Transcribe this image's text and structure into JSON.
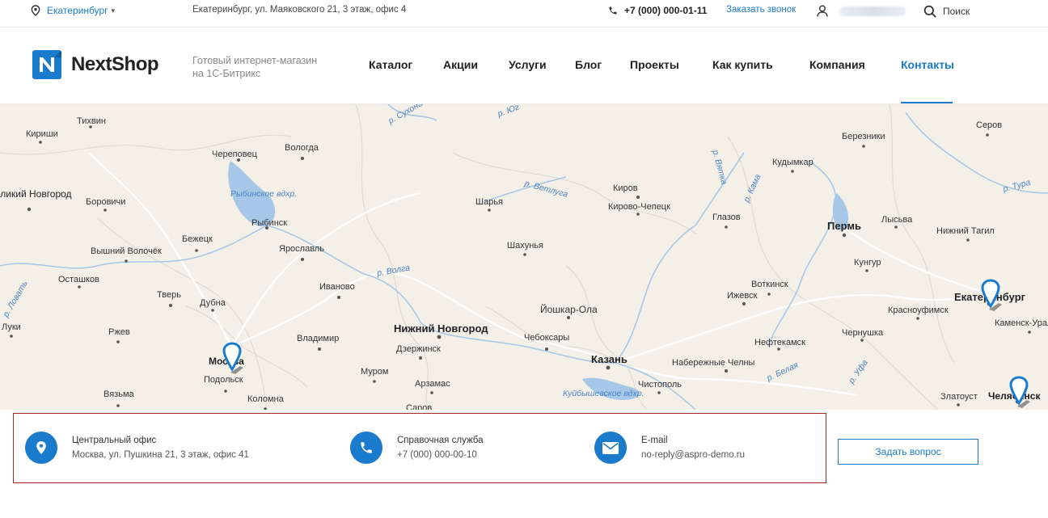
{
  "topbar": {
    "city": "Екатеринбург",
    "address": "Екатеринбург, ул. Маяковского 21, 3 этаж, офис 4",
    "phone": "+7 (000) 000-01-11",
    "callback": "Заказать звонок",
    "search": "Поиск"
  },
  "header": {
    "logo_letter": "N",
    "logo_name": "NextShop",
    "tagline": "Готовый интернет-магазин на 1С-Битрикс",
    "accent_color": "#1a7acb"
  },
  "nav": {
    "items": [
      {
        "label": "Каталог"
      },
      {
        "label": "Акции"
      },
      {
        "label": "Услуги"
      },
      {
        "label": "Блог"
      },
      {
        "label": "Проекты"
      },
      {
        "label": "Как купить"
      },
      {
        "label": "Компания"
      },
      {
        "label": "Контакты",
        "active": true
      }
    ]
  },
  "map": {
    "cities": [
      "Тихвин",
      "Кириши",
      "Череповец",
      "Вологда",
      "Великий Новгород",
      "Боровичи",
      "Рыбинск",
      "Бежецк",
      "Вышний Волочёк",
      "Ярославль",
      "Осташков",
      "Тверь",
      "Дубна",
      "Иваново",
      "Луки",
      "Ржев",
      "Москва",
      "Подольск",
      "Вязьма",
      "Коломна",
      "Владимир",
      "Нижний Новгород",
      "Дзержинск",
      "Муром",
      "Арзамас",
      "Саров",
      "Шарья",
      "Шахунья",
      "Йошкар-Ола",
      "Чебоксары",
      "Казань",
      "Киров",
      "Кирово-Чепецк",
      "Глазов",
      "Кудымкар",
      "Березники",
      "Серов",
      "Пермь",
      "Лысьва",
      "Нижний Тагил",
      "Кунгур",
      "Воткинск",
      "Ижевск",
      "Красноуфимск",
      "Екатеринбург",
      "Каменск-Уральский",
      "Нефтекамск",
      "Чернушка",
      "Набережные Челны",
      "Чистополь",
      "Златоуст",
      "Челябинск"
    ],
    "rivers": [
      "р. Сухона",
      "р. Юг",
      "р. Ветлуга",
      "р. Вятка",
      "р. Кама",
      "р. Тура",
      "р. Ловать",
      "р. Волга",
      "р. Белая",
      "р. Уфа"
    ],
    "lakes": [
      "Рыбинское вдхр.",
      "Куйбышевское вдхр."
    ],
    "pins": [
      "Москва",
      "Екатеринбург",
      "Челябинск"
    ]
  },
  "contacts": {
    "office": {
      "title": "Центральный офис",
      "value": "Москва, ул. Пушкина 21, 3 этаж, офис 41"
    },
    "service": {
      "title": "Справочная служба",
      "value": "+7 (000) 000-00-10"
    },
    "email": {
      "title": "E-mail",
      "value": "no-reply@aspro-demo.ru"
    }
  },
  "ask_button": "Задать вопрос"
}
